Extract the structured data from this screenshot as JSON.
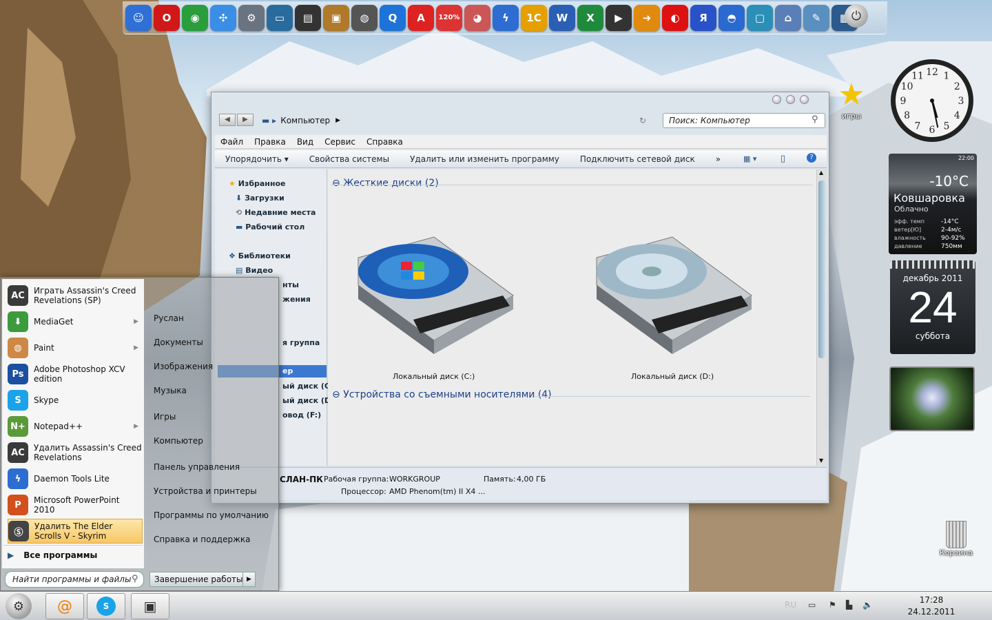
{
  "dock": {
    "items": [
      {
        "name": "finder-icon",
        "glyph": "☺",
        "color": "#2f6fd6"
      },
      {
        "name": "opera-icon",
        "glyph": "O",
        "color": "#d01818"
      },
      {
        "name": "chrome-icon",
        "glyph": "◉",
        "color": "#2a9d3c"
      },
      {
        "name": "safari-icon",
        "glyph": "✣",
        "color": "#3a8ee6"
      },
      {
        "name": "system-settings-icon",
        "glyph": "⚙",
        "color": "#6a7380"
      },
      {
        "name": "monitor-icon",
        "glyph": "▭",
        "color": "#2a6b9e"
      },
      {
        "name": "clapper-icon",
        "glyph": "▤",
        "color": "#333"
      },
      {
        "name": "image-viewer-icon",
        "glyph": "▣",
        "color": "#b07a2a"
      },
      {
        "name": "camera-icon",
        "glyph": "◍",
        "color": "#555"
      },
      {
        "name": "quicktime-icon",
        "glyph": "Q",
        "color": "#1e73d8"
      },
      {
        "name": "acrobat-icon",
        "glyph": "A",
        "color": "#d22"
      },
      {
        "name": "hdd-120-icon",
        "glyph": "120%",
        "color": "#d33"
      },
      {
        "name": "browser-globe-icon",
        "glyph": "◕",
        "color": "#c55"
      },
      {
        "name": "daemon-tools-icon",
        "glyph": "ϟ",
        "color": "#2d6dd2"
      },
      {
        "name": "1c-icon",
        "glyph": "1C",
        "color": "#e5a000"
      },
      {
        "name": "word-icon",
        "glyph": "W",
        "color": "#2b5fb4"
      },
      {
        "name": "excel-icon",
        "glyph": "X",
        "color": "#1f8a3b"
      },
      {
        "name": "media-player-icon",
        "glyph": "▶",
        "color": "#333"
      },
      {
        "name": "arrow-app-icon",
        "glyph": "➜",
        "color": "#e08a10"
      },
      {
        "name": "record-icon",
        "glyph": "◐",
        "color": "#d11"
      },
      {
        "name": "yandex-icon",
        "glyph": "Я",
        "color": "#2a52c8"
      },
      {
        "name": "planet-icon",
        "glyph": "◓",
        "color": "#2a6ad0"
      },
      {
        "name": "desktop-icon",
        "glyph": "▢",
        "color": "#2b8fb8"
      },
      {
        "name": "network-icon",
        "glyph": "⌂",
        "color": "#5a7fb8"
      },
      {
        "name": "tools-icon",
        "glyph": "✎",
        "color": "#5a90c0"
      },
      {
        "name": "control-panel-icon",
        "glyph": "▦",
        "color": "#2c5a8c"
      }
    ]
  },
  "window": {
    "breadcrumb": "Компьютер",
    "search_placeholder": "Поиск: Компьютер",
    "menu": [
      "Файл",
      "Правка",
      "Вид",
      "Сервис",
      "Справка"
    ],
    "commands": [
      "Упорядочить",
      "Свойства системы",
      "Удалить или изменить программу",
      "Подключить сетевой диск",
      "»"
    ],
    "nav": {
      "favorites": "Избранное",
      "downloads": "Загрузки",
      "recent": "Недавние места",
      "desktop": "Рабочий стол",
      "libraries": "Библиотеки",
      "video": "Видео",
      "documents_tail": "нты",
      "images_tail": "жения",
      "homegroup_tail": "я группа",
      "computer_tail": "ер",
      "disk_c_tail": "ый диск (C:)",
      "disk_d_tail": "ый диск (D:)",
      "drive_f_tail": "овод (F:)"
    },
    "groups": {
      "hdd": "Жесткие диски (2)",
      "removable": "Устройства со съемными носителями (4)"
    },
    "drives": [
      "Локальный диск (C:)",
      "Локальный диск (D:)"
    ],
    "details": {
      "pc": "СЛАН-ПК",
      "workgroup_label": "Рабочая группа:",
      "workgroup": "WORKGROUP",
      "memory_label": "Память:",
      "memory": "4,00 ГБ",
      "cpu_label": "Процессор:",
      "cpu": "AMD Phenom(tm) II X4 ..."
    }
  },
  "start_menu": {
    "items": [
      {
        "label": "Играть Assassin's Creed Revelations (SP)",
        "icon": "AC",
        "color": "#3a3a3a",
        "arrow": false
      },
      {
        "label": "MediaGet",
        "icon": "⬇",
        "color": "#3c9b3c",
        "arrow": true
      },
      {
        "label": "Paint",
        "icon": "◍",
        "color": "#c84",
        "arrow": true
      },
      {
        "label": "Adobe Photoshop XCV edition",
        "icon": "Ps",
        "color": "#1b4fa0",
        "arrow": false
      },
      {
        "label": "Skype",
        "icon": "S",
        "color": "#1aa3e8",
        "arrow": false
      },
      {
        "label": "Notepad++",
        "icon": "N+",
        "color": "#5a9a3a",
        "arrow": true
      },
      {
        "label": "Удалить Assassin's Creed Revelations",
        "icon": "AC",
        "color": "#3a3a3a",
        "arrow": false
      },
      {
        "label": "Daemon Tools Lite",
        "icon": "ϟ",
        "color": "#2d6dd2",
        "arrow": false
      },
      {
        "label": "Microsoft PowerPoint 2010",
        "icon": "P",
        "color": "#d24f1e",
        "arrow": false
      },
      {
        "label": "Удалить The Elder Scrolls V - Skyrim",
        "icon": "Ⓢ",
        "color": "#444",
        "arrow": false
      }
    ],
    "all_programs": "Все программы",
    "search_placeholder": "Найти программы и файлы",
    "right": [
      "Руслан",
      "Документы",
      "Изображения",
      "Музыка",
      "Игры",
      "Компьютер",
      "Панель управления",
      "Устройства и принтеры",
      "Программы по умолчанию",
      "Справка и поддержка"
    ],
    "shutdown": "Завершение работы"
  },
  "taskbar": {
    "lang": "RU",
    "time": "17:28",
    "date": "24.12.2011"
  },
  "gadgets": {
    "weather": {
      "time": "22:00",
      "temp": "-10°C",
      "city": "Ковшаровка",
      "cond": "Облачно",
      "rows": [
        [
          "эфф. темп",
          "-14°C"
        ],
        [
          "ветер[Ю]",
          "2-4м/с"
        ],
        [
          "влажность",
          "90-92%"
        ],
        [
          "давление",
          "750мм"
        ]
      ]
    },
    "calendar": {
      "month": "декабрь 2011",
      "day": "24",
      "weekday": "суббота"
    },
    "clock": {
      "hour": 5,
      "minute": 28
    }
  },
  "desktop": {
    "games_label": "игры",
    "trash_label": "Корзина"
  }
}
